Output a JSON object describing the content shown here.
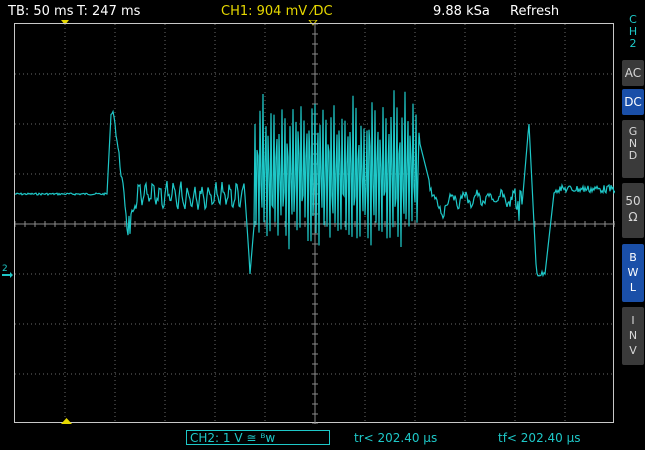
{
  "header": {
    "timebase": "TB: 50 ms",
    "trigger_time": "T: 247 ms",
    "ch1_setting": "CH1: 904 mV ⁄DC",
    "sample_rate": "9.88 kSa",
    "mode": "Refresh"
  },
  "sidebar": {
    "channel_label": [
      "C",
      "H",
      "2"
    ],
    "buttons": [
      {
        "label": "AC",
        "active": false
      },
      {
        "label": "DC",
        "active": true
      },
      {
        "label": "G\nN\nD",
        "active": false
      },
      {
        "label": "50\nΩ",
        "active": false
      },
      {
        "label": "B\nW\nL",
        "active": true
      },
      {
        "label": "I\nN\nV",
        "active": false
      }
    ]
  },
  "plot": {
    "channel_marker_label": "2"
  },
  "footer": {
    "ch2_setting": "CH2: 1 V ≅ ᴮw",
    "rise_time": "tr< 202.40 µs",
    "fall_time": "tf< 202.40 µs"
  },
  "colors": {
    "trace": "#1ec8c8",
    "ch1": "#e6d800",
    "grid": "#6a6a6a",
    "text": "#ffffff"
  }
}
